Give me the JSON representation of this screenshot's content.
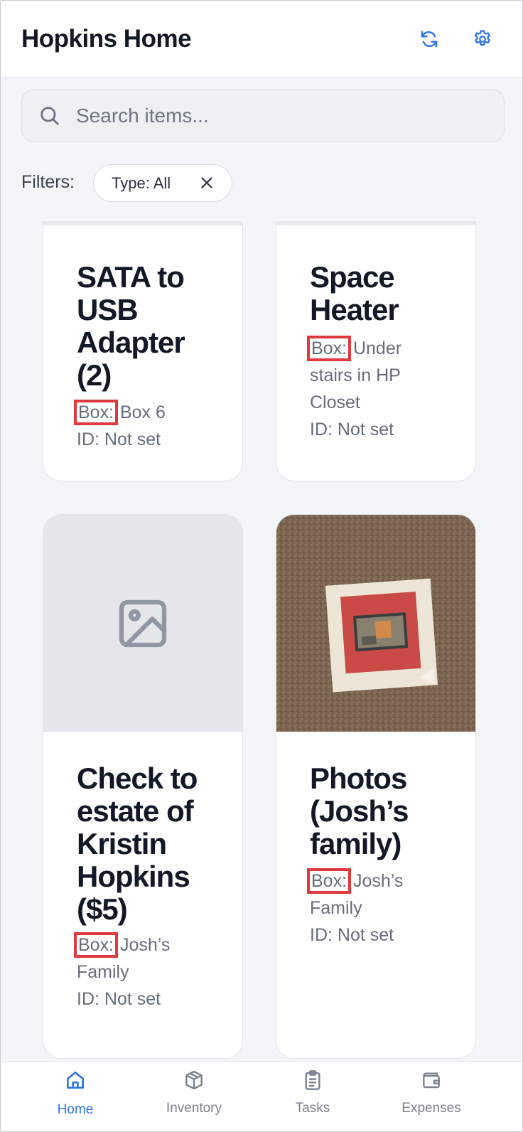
{
  "header": {
    "title": "Hopkins Home",
    "refresh_icon": "refresh-icon",
    "settings_icon": "gear-icon"
  },
  "search": {
    "placeholder": "Search items...",
    "value": ""
  },
  "filters": {
    "label": "Filters:",
    "chips": [
      {
        "label": "Type: All"
      }
    ]
  },
  "items": [
    {
      "title_lines": [
        "SATA to",
        "USB",
        "Adapter",
        "(2)"
      ],
      "box_label": "Box:",
      "box_value": " Box 6",
      "box_value_cont": "",
      "id_text": "ID: Not set",
      "image": "none"
    },
    {
      "title_lines": [
        "Space",
        "Heater"
      ],
      "box_label": "Box:",
      "box_value": " Under",
      "box_value_lines": [
        "stairs in HP",
        "Closet"
      ],
      "id_text": "ID: Not set",
      "image": "none"
    },
    {
      "title_lines": [
        "Check to",
        "estate of",
        "Kristin",
        "Hopkins",
        "($5)"
      ],
      "box_label": "Box:",
      "box_value": " Josh’s",
      "box_value_lines": [
        "Family"
      ],
      "id_text": "ID: Not set",
      "image": "placeholder"
    },
    {
      "title_lines": [
        "Photos",
        "(Josh’s",
        "family)"
      ],
      "box_label": "Box:",
      "box_value": " Josh’s",
      "box_value_lines": [
        "Family"
      ],
      "id_text": "ID: Not set",
      "image": "photo"
    }
  ],
  "nav": {
    "items": [
      {
        "label": "Home",
        "icon": "home-icon",
        "active": true
      },
      {
        "label": "Inventory",
        "icon": "box-icon",
        "active": false
      },
      {
        "label": "Tasks",
        "icon": "clipboard-icon",
        "active": false
      },
      {
        "label": "Expenses",
        "icon": "wallet-icon",
        "active": false
      }
    ]
  },
  "colors": {
    "accent": "#2f74e8",
    "highlight": "#e0393e",
    "background": "#f3f5f8"
  }
}
